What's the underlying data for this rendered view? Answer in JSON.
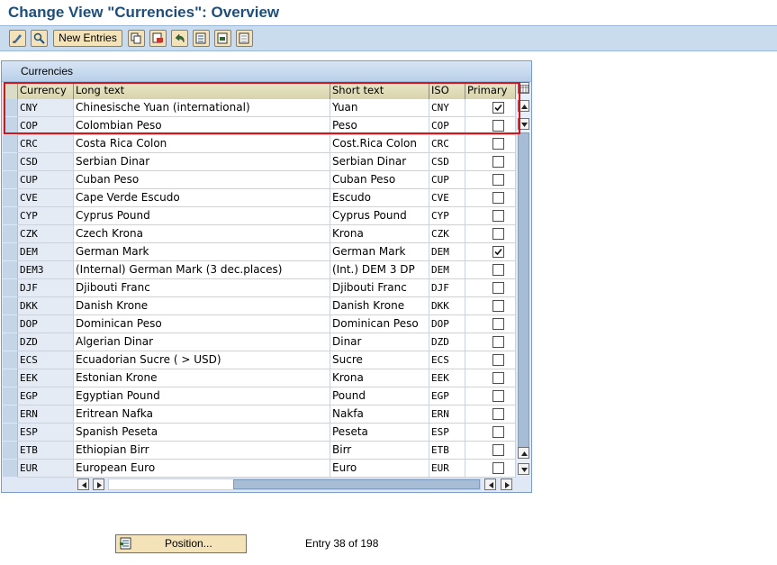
{
  "window": {
    "title": "Change View \"Currencies\": Overview"
  },
  "toolbar": {
    "new_entries_label": "New Entries",
    "icons": [
      "display-change-icon",
      "find-icon",
      "copy-icon",
      "delete-icon",
      "undo-icon",
      "select-all-icon",
      "select-block-icon",
      "deselect-all-icon"
    ]
  },
  "table": {
    "title": "Currencies",
    "columns": [
      "Currency",
      "Long text",
      "Short text",
      "ISO",
      "Primary"
    ],
    "rows": [
      {
        "currency": "CNY",
        "long": "Chinesische Yuan (international)",
        "short": "Yuan",
        "iso": "CNY",
        "primary": true
      },
      {
        "currency": "COP",
        "long": "Colombian Peso",
        "short": "Peso",
        "iso": "COP",
        "primary": false
      },
      {
        "currency": "CRC",
        "long": "Costa Rica Colon",
        "short": "Cost.Rica Colon",
        "iso": "CRC",
        "primary": false
      },
      {
        "currency": "CSD",
        "long": "Serbian Dinar",
        "short": "Serbian Dinar",
        "iso": "CSD",
        "primary": false
      },
      {
        "currency": "CUP",
        "long": "Cuban Peso",
        "short": "Cuban Peso",
        "iso": "CUP",
        "primary": false
      },
      {
        "currency": "CVE",
        "long": "Cape Verde Escudo",
        "short": "Escudo",
        "iso": "CVE",
        "primary": false
      },
      {
        "currency": "CYP",
        "long": "Cyprus Pound",
        "short": "Cyprus Pound",
        "iso": "CYP",
        "primary": false
      },
      {
        "currency": "CZK",
        "long": "Czech Krona",
        "short": "Krona",
        "iso": "CZK",
        "primary": false
      },
      {
        "currency": "DEM",
        "long": "German Mark",
        "short": "German Mark",
        "iso": "DEM",
        "primary": true
      },
      {
        "currency": "DEM3",
        "long": "(Internal) German Mark (3 dec.places)",
        "short": "(Int.) DEM 3 DP",
        "iso": "DEM",
        "primary": false
      },
      {
        "currency": "DJF",
        "long": "Djibouti Franc",
        "short": "Djibouti Franc",
        "iso": "DJF",
        "primary": false
      },
      {
        "currency": "DKK",
        "long": "Danish Krone",
        "short": "Danish Krone",
        "iso": "DKK",
        "primary": false
      },
      {
        "currency": "DOP",
        "long": "Dominican Peso",
        "short": "Dominican Peso",
        "iso": "DOP",
        "primary": false
      },
      {
        "currency": "DZD",
        "long": "Algerian Dinar",
        "short": "Dinar",
        "iso": "DZD",
        "primary": false
      },
      {
        "currency": "ECS",
        "long": "Ecuadorian Sucre (  > USD)",
        "short": "Sucre",
        "iso": "ECS",
        "primary": false
      },
      {
        "currency": "EEK",
        "long": "Estonian Krone",
        "short": "Krona",
        "iso": "EEK",
        "primary": false
      },
      {
        "currency": "EGP",
        "long": "Egyptian Pound",
        "short": "Pound",
        "iso": "EGP",
        "primary": false
      },
      {
        "currency": "ERN",
        "long": "Eritrean Nafka",
        "short": "Nakfa",
        "iso": "ERN",
        "primary": false
      },
      {
        "currency": "ESP",
        "long": "Spanish Peseta",
        "short": "Peseta",
        "iso": "ESP",
        "primary": false
      },
      {
        "currency": "ETB",
        "long": "Ethiopian Birr",
        "short": "Birr",
        "iso": "ETB",
        "primary": false
      },
      {
        "currency": "EUR",
        "long": "European Euro",
        "short": "Euro",
        "iso": "EUR",
        "primary": false
      }
    ]
  },
  "footer": {
    "position_label": "Position...",
    "entry_text": "Entry 38 of 198"
  },
  "colors": {
    "title": "#1f4e79",
    "toolbar": "#c9dcee",
    "highlight": "#d4151b",
    "button": "#f4e3b8"
  }
}
